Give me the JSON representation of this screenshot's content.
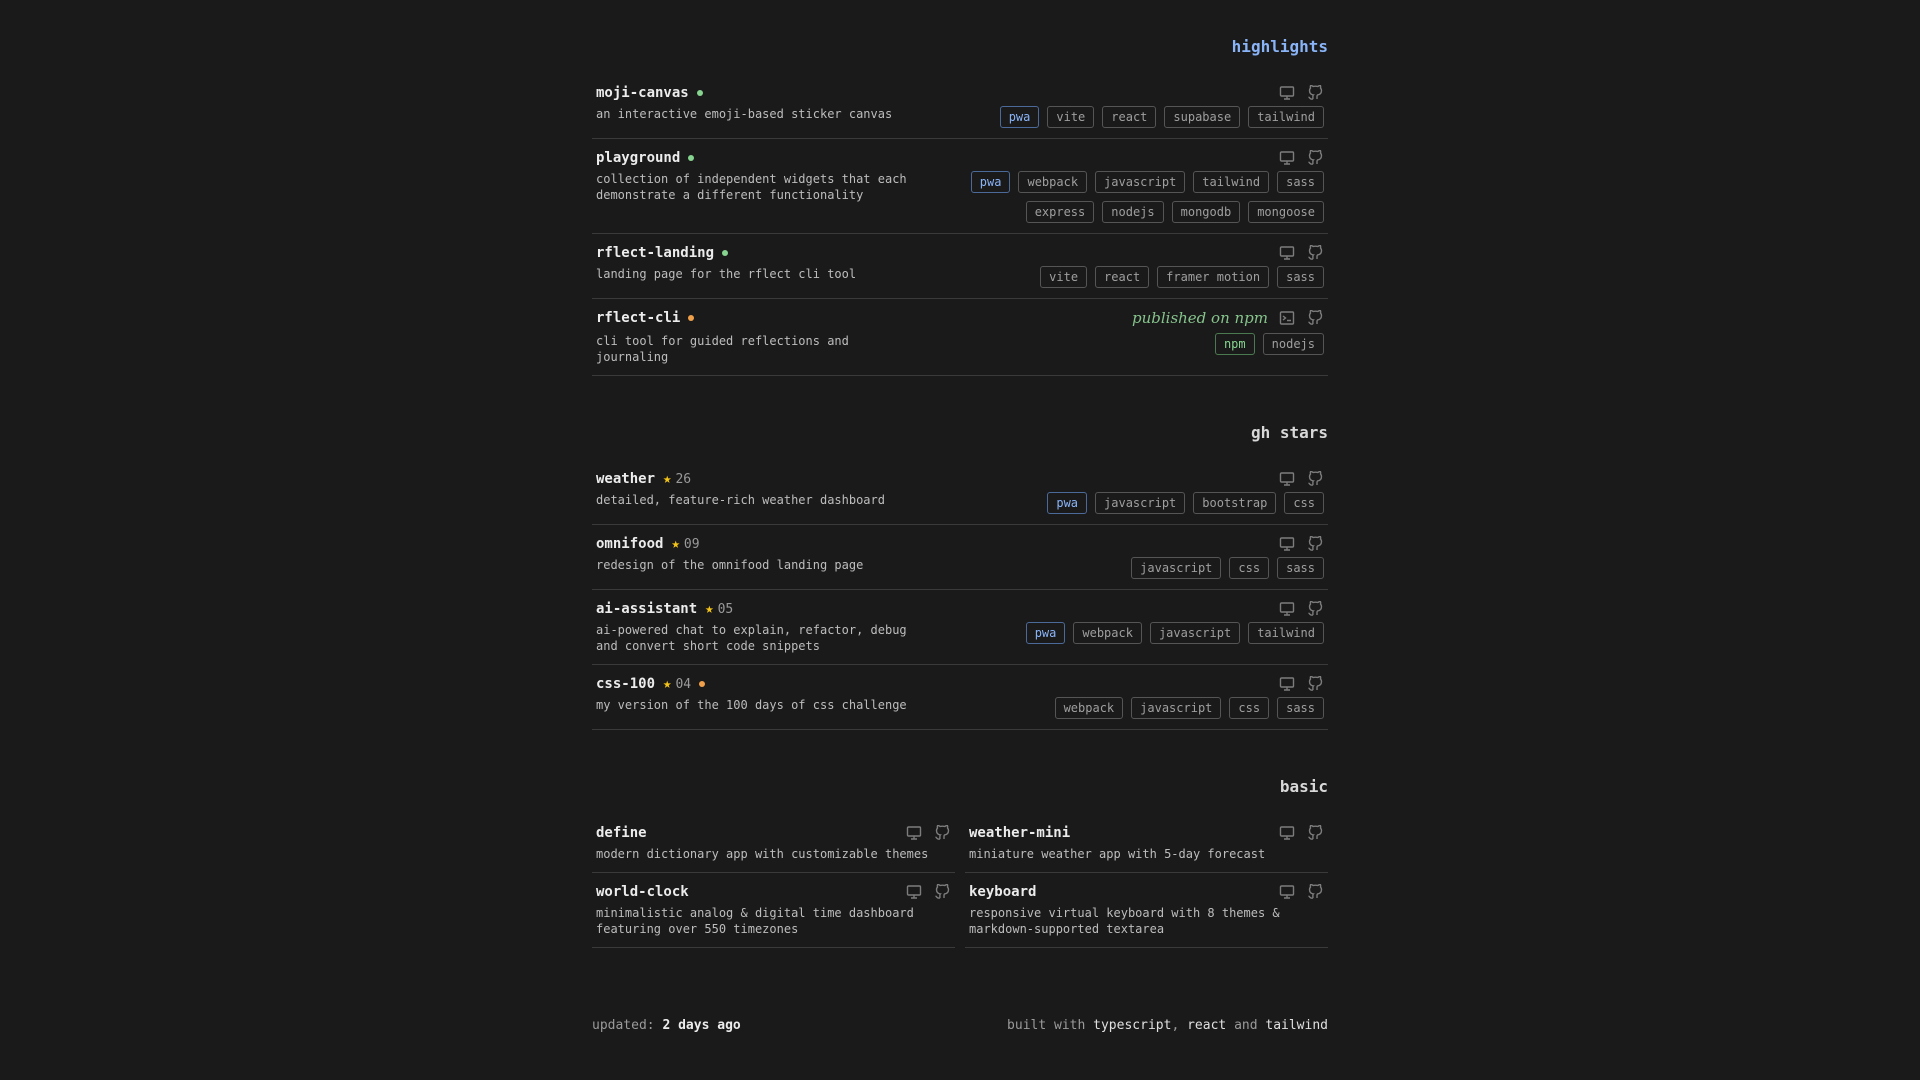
{
  "sections": {
    "highlights": "highlights",
    "gh_stars": "gh stars",
    "basic": "basic"
  },
  "highlights": [
    {
      "name": "moji-canvas",
      "desc": "an interactive emoji-based sticker canvas",
      "status": "green",
      "tags": [
        {
          "t": "pwa",
          "c": "blue"
        },
        {
          "t": "vite"
        },
        {
          "t": "react"
        },
        {
          "t": "supabase"
        },
        {
          "t": "tailwind"
        }
      ]
    },
    {
      "name": "playground",
      "desc": "collection of independent widgets that each demonstrate a different functionality",
      "status": "green",
      "tags": [
        {
          "t": "pwa",
          "c": "blue"
        },
        {
          "t": "webpack"
        },
        {
          "t": "javascript"
        },
        {
          "t": "tailwind"
        },
        {
          "t": "sass"
        },
        {
          "t": "express"
        },
        {
          "t": "nodejs"
        },
        {
          "t": "mongodb"
        },
        {
          "t": "mongoose"
        }
      ]
    },
    {
      "name": "rflect-landing",
      "desc": "landing page for the rflect cli tool",
      "status": "green",
      "tags": [
        {
          "t": "vite"
        },
        {
          "t": "react"
        },
        {
          "t": "framer motion"
        },
        {
          "t": "sass"
        }
      ]
    },
    {
      "name": "rflect-cli",
      "desc": "cli tool for guided reflections and journaling",
      "status": "orange",
      "note": "published on npm",
      "terminal": true,
      "tags": [
        {
          "t": "npm",
          "c": "green"
        },
        {
          "t": "nodejs"
        }
      ]
    }
  ],
  "gh_stars": [
    {
      "name": "weather",
      "stars": "26",
      "desc": "detailed, feature-rich weather dashboard",
      "tags": [
        {
          "t": "pwa",
          "c": "blue"
        },
        {
          "t": "javascript"
        },
        {
          "t": "bootstrap"
        },
        {
          "t": "css"
        }
      ]
    },
    {
      "name": "omnifood",
      "stars": "09",
      "desc": "redesign of the omnifood landing page",
      "tags": [
        {
          "t": "javascript"
        },
        {
          "t": "css"
        },
        {
          "t": "sass"
        }
      ]
    },
    {
      "name": "ai-assistant",
      "stars": "05",
      "desc": "ai-powered chat to explain, refactor, debug and convert short code snippets",
      "tags": [
        {
          "t": "pwa",
          "c": "blue"
        },
        {
          "t": "webpack"
        },
        {
          "t": "javascript"
        },
        {
          "t": "tailwind"
        }
      ]
    },
    {
      "name": "css-100",
      "stars": "04",
      "status": "orange",
      "desc": "my version of the 100 days of css challenge",
      "tags": [
        {
          "t": "webpack"
        },
        {
          "t": "javascript"
        },
        {
          "t": "css"
        },
        {
          "t": "sass"
        }
      ]
    }
  ],
  "basic": [
    {
      "name": "define",
      "desc": "modern dictionary app with customizable themes"
    },
    {
      "name": "weather-mini",
      "desc": "miniature weather app with 5-day forecast"
    },
    {
      "name": "world-clock",
      "desc": "minimalistic analog & digital time dashboard featuring over 550 timezones"
    },
    {
      "name": "keyboard",
      "desc": "responsive virtual keyboard with 8 themes & markdown-supported textarea"
    }
  ],
  "footer": {
    "updated_label": "updated:",
    "updated_value": "2 days ago",
    "built_with": "built with",
    "tech1": "typescript",
    "sep": ",",
    "tech2": "react",
    "and": "and",
    "tech3": "tailwind"
  },
  "icons": {
    "demo": "monitor-icon",
    "repo": "github-icon",
    "cli": "terminal-icon"
  }
}
